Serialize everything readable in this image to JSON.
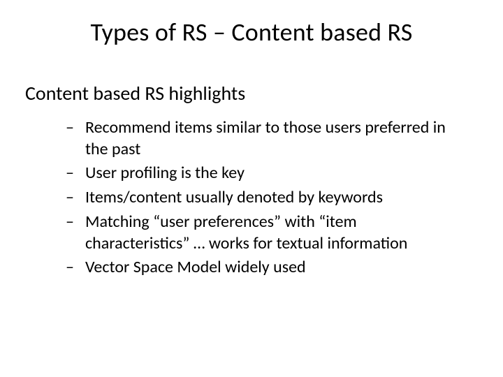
{
  "title": "Types of RS – Content based RS",
  "subhead": "Content based RS highlights",
  "dash": "–",
  "bullets": [
    "Recommend items similar to those users preferred in the past",
    "User profiling is the key",
    "Items/content usually denoted by keywords",
    "Matching “user preferences” with “item characteristics” … works for textual information",
    "Vector Space Model widely used"
  ]
}
